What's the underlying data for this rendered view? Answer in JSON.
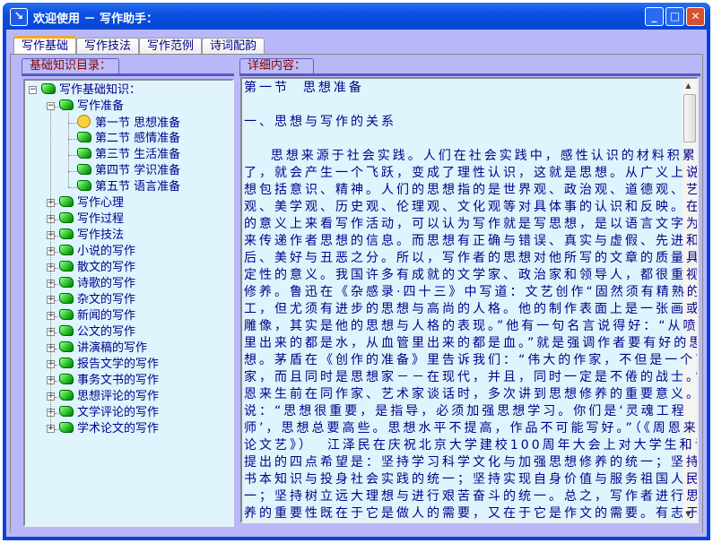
{
  "window": {
    "title": "欢迎使用 － 写作助手：",
    "minimize": "_",
    "maximize": "□",
    "close": "✕",
    "app_icon": "↘"
  },
  "tabs": [
    {
      "label": "写作基础",
      "active": true
    },
    {
      "label": "写作技法"
    },
    {
      "label": "写作范例"
    },
    {
      "label": "诗词配韵"
    }
  ],
  "left_panel": {
    "label": "基础知识目录：",
    "root": "写作基础知识：",
    "expanded": "写作准备",
    "sections": [
      "第一节  思想准备",
      "第二节  感情准备",
      "第三节  生活准备",
      "第四节  学识准备",
      "第五节  语言准备"
    ],
    "collapsed": [
      "写作心理",
      "写作过程",
      "写作技法",
      "小说的写作",
      "散文的写作",
      "诗歌的写作",
      "杂文的写作",
      "新闻的写作",
      "公文的写作",
      "讲演稿的写作",
      "报告文学的写作",
      "事务文书的写作",
      "思想评论的写作",
      "文学评论的写作",
      "学术论文的写作"
    ]
  },
  "right_panel": {
    "label": "详细内容：",
    "lines": [
      "第一节  思想准备",
      "",
      "一、思想与写作的关系",
      "",
      "    思想来源于社会实践。人们在社会实践中，感性认识的材料积累多",
      "了，就会产生一个飞跃，变成了理性认识，这就是思想。从广义上说，思",
      "想包括意识、精神。人们的思想指的是世界观、政治观、道德观、艺术",
      "观、美学观、历史观、伦理观、文化观等对具体事的认识和反映。在一定",
      "的意义上来看写作活动，可以认为写作就是写思想，是以语言文字为媒介",
      "来传递作者思想的信息。而思想有正确与错误、真实与虚假、先进和落",
      "后、美好与丑恶之分。所以，写作者的思想对他所写的文章的质量具有决",
      "定性的意义。我国许多有成就的文学家、政治家和领导人，都很重视思想",
      "修养。鲁迅在《杂感录·四十三》中写道：文艺创作“固然须有精熟的技",
      "工，但尤须有进步的思想与高尚的人格。他的制作表面上是一张画或一个",
      "雕像，其实是他的思想与人格的表现。”他有一句名言说得好：“从喷泉",
      "里出来的都是水，从血管里出来的都是血。”就是强调作者要有好的思",
      "想。茅盾在《创作的准备》里告诉我们：“伟大的作家，不但是一个艺术",
      "家，而且同时是思想家－－在现代，并且，同时一定是不倦的战士。”周",
      "恩来生前在同作家、艺术家谈话时，多次讲到思想修养的重要意义。他",
      "说：“思想很重要，是指导，必须加强思想学习。你们是‘灵魂工程",
      "师’，思想总要高些。思想水平不提高，作品不可能写好。”（《周恩来",
      "论文艺》）  江泽民在庆祝北京大学建校100周年大会上对大学生和青年人",
      "提出的四点希望是：坚持学习科学文化与加强思想修养的统一；坚持学习",
      "书本知识与投身社会实践的统一；坚持实现自身价值与服务祖国人民的统",
      "一；坚持树立远大理想与进行艰苦奋斗的统一。总之，写作者进行思想修",
      "养的重要性既在于它是做人的需要，又在于它是作文的需要。有志于学习"
    ]
  }
}
